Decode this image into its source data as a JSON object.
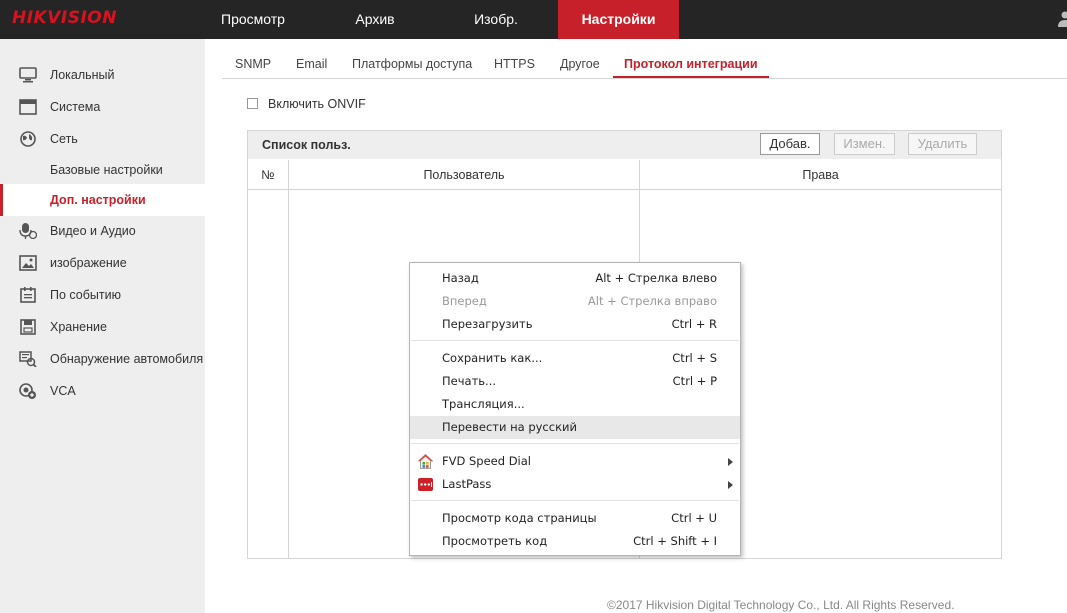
{
  "brand": {
    "logo": "HIKVISION",
    "accent": "#c8202a"
  },
  "nav": {
    "items": [
      "Просмотр",
      "Архив",
      "Изобр.",
      "Настройки"
    ],
    "active": "Настройки"
  },
  "sidebar": {
    "items": [
      {
        "label": "Локальный",
        "icon": "monitor-icon"
      },
      {
        "label": "Система",
        "icon": "system-icon"
      },
      {
        "label": "Сеть",
        "icon": "globe-icon"
      },
      {
        "label": "Базовые настройки"
      },
      {
        "label": "Доп. настройки",
        "active": true
      },
      {
        "label": "Видео и Аудио",
        "icon": "microphone-icon"
      },
      {
        "label": "изображение",
        "icon": "image-icon"
      },
      {
        "label": "По событию",
        "icon": "calendar-icon"
      },
      {
        "label": "Хранение",
        "icon": "storage-icon"
      },
      {
        "label": "Обнаружение автомобиля",
        "icon": "vehicle-detection-icon"
      },
      {
        "label": "VCA",
        "icon": "vca-icon"
      }
    ]
  },
  "tabs": {
    "items": [
      "SNMP",
      "Email",
      "Платформы доступа",
      "HTTPS",
      "Другое",
      "Протокол интеграции"
    ],
    "active": "Протокол интеграции"
  },
  "onvif": {
    "label": "Включить ONVIF",
    "checked": false
  },
  "userlist": {
    "title": "Список польз.",
    "add": "Добав.",
    "edit": "Измен.",
    "delete": "Удалить",
    "columns": [
      "№",
      "Пользователь",
      "Права"
    ],
    "rows": []
  },
  "context_menu": {
    "items": [
      {
        "label": "Назад",
        "shortcut": "Alt + Стрелка влево"
      },
      {
        "label": "Вперед",
        "shortcut": "Alt + Стрелка вправо",
        "disabled": true
      },
      {
        "label": "Перезагрузить",
        "shortcut": "Ctrl + R"
      },
      {
        "label": "Сохранить как...",
        "shortcut": "Ctrl + S"
      },
      {
        "label": "Печать...",
        "shortcut": "Ctrl + P"
      },
      {
        "label": "Трансляция..."
      },
      {
        "label": "Перевести на русский",
        "highlighted": true
      },
      {
        "label": "FVD Speed Dial",
        "icon": "fvd-speed-dial-icon",
        "submenu": true
      },
      {
        "label": "LastPass",
        "icon": "lastpass-icon",
        "submenu": true
      },
      {
        "label": "Просмотр кода страницы",
        "shortcut": "Ctrl + U"
      },
      {
        "label": "Просмотреть код",
        "shortcut": "Ctrl + Shift + I"
      }
    ]
  },
  "footer": {
    "copyright": "©2017 Hikvision Digital Technology Co., Ltd. All Rights Reserved."
  }
}
